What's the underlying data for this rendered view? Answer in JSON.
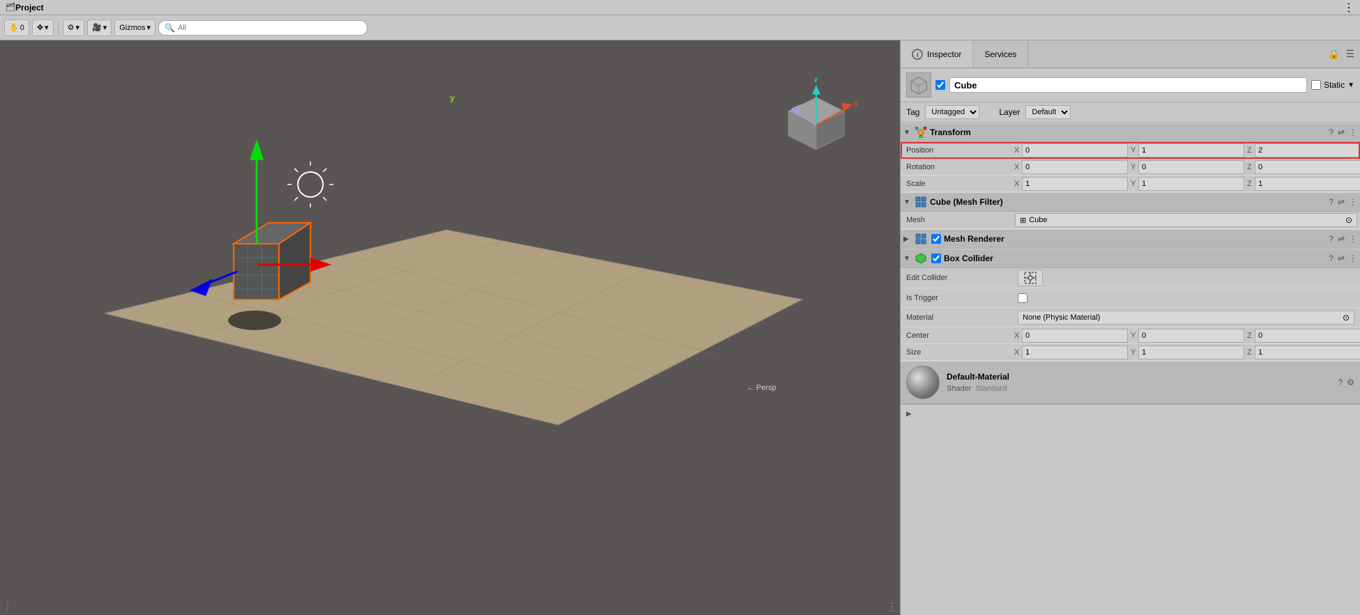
{
  "topbar": {
    "title": "Project",
    "folder_icon": "🗂"
  },
  "toolbar": {
    "hand_icon": "☰",
    "move_icon": "✥",
    "dropdown_arrow": "▾",
    "tools_icon": "⚙",
    "camera_icon": "🎥",
    "gizmos_label": "Gizmos",
    "search_placeholder": "All",
    "search_icon": "🔍"
  },
  "viewport": {
    "persp_label": "← Persp",
    "y_label": "y"
  },
  "inspector": {
    "tabs": [
      {
        "label": "Inspector",
        "icon": "ℹ",
        "active": true
      },
      {
        "label": "Services",
        "icon": "",
        "active": false
      }
    ],
    "lock_icon": "🔒",
    "menu_icon": "☰",
    "object": {
      "name": "Cube",
      "enabled": true,
      "static_label": "Static",
      "static_checked": false,
      "tag_label": "Tag",
      "tag_value": "Untagged",
      "layer_label": "Layer",
      "layer_value": "Default"
    },
    "transform": {
      "title": "Transform",
      "expanded": true,
      "position": {
        "label": "Position",
        "x": "0",
        "y": "1",
        "z": "2",
        "highlighted": true
      },
      "rotation": {
        "label": "Rotation",
        "x": "0",
        "y": "0",
        "z": "0"
      },
      "scale": {
        "label": "Scale",
        "x": "1",
        "y": "1",
        "z": "1"
      }
    },
    "mesh_filter": {
      "title": "Cube (Mesh Filter)",
      "expanded": true,
      "mesh_label": "Mesh",
      "mesh_value": "Cube",
      "mesh_icon": "⊞"
    },
    "mesh_renderer": {
      "title": "Mesh Renderer",
      "expanded": false,
      "enabled": true
    },
    "box_collider": {
      "title": "Box Collider",
      "expanded": true,
      "enabled": true,
      "edit_collider_label": "Edit Collider",
      "edit_icon": "🔧",
      "is_trigger_label": "Is Trigger",
      "material_label": "Material",
      "material_value": "None (Physic Material)",
      "center_label": "Center",
      "center_x": "0",
      "center_y": "0",
      "center_z": "0",
      "size_label": "Size",
      "size_x": "1",
      "size_y": "1",
      "size_z": "1"
    },
    "material_section": {
      "name": "Default-Material",
      "shader_label": "Shader",
      "shader_value": "Standard"
    }
  }
}
